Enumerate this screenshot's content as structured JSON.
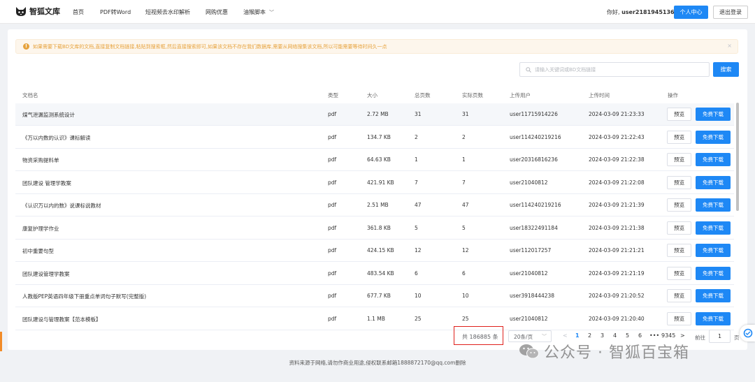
{
  "header": {
    "brand": "智狐文库",
    "nav": [
      "首页",
      "PDF转Word",
      "短视频去水印解析",
      "网购优惠",
      "油猴脚本"
    ],
    "greeting": "你好,",
    "username": "user2181945136",
    "personal_center": "个人中心",
    "logout": "退出登录"
  },
  "notice": {
    "text": "如果需要下载BD文库的文档,直接复制文档链接,粘贴到搜索框,然后直接搜索即可,如果该文档不存在我们数据库,需要从网络搜集该文档,所以可能需要等待时间久一点",
    "close": "×"
  },
  "search": {
    "placeholder": "请输入关键词或BD文档链接",
    "button": "搜索"
  },
  "table": {
    "columns": [
      "文档名",
      "类型",
      "大小",
      "总页数",
      "实际页数",
      "上传用户",
      "上传时间",
      "操作"
    ],
    "preview_label": "预览",
    "download_label": "免费下载",
    "rows": [
      {
        "name": "煤气泄漏监测系统设计",
        "type": "pdf",
        "size": "2.72 MB",
        "total": "31",
        "actual": "31",
        "user": "user11715914226",
        "time": "2024-03-09 21:23:33"
      },
      {
        "name": "《万以内数的认识》课标解读",
        "type": "pdf",
        "size": "134.7 KB",
        "total": "2",
        "actual": "2",
        "user": "user114240219216",
        "time": "2024-03-09 21:22:43"
      },
      {
        "name": "物资采购提料单",
        "type": "pdf",
        "size": "64.63 KB",
        "total": "1",
        "actual": "1",
        "user": "user20316816236",
        "time": "2024-03-09 21:22:38"
      },
      {
        "name": "团队建设 管理学教案",
        "type": "pdf",
        "size": "421.91 KB",
        "total": "7",
        "actual": "7",
        "user": "user21040812",
        "time": "2024-03-09 21:22:08"
      },
      {
        "name": "《认识万以内的数》说课标说教材",
        "type": "pdf",
        "size": "2.51 MB",
        "total": "47",
        "actual": "47",
        "user": "user114240219216",
        "time": "2024-03-09 21:21:39"
      },
      {
        "name": "康复护理学作业",
        "type": "pdf",
        "size": "361.8 KB",
        "total": "5",
        "actual": "5",
        "user": "user18322491184",
        "time": "2024-03-09 21:21:38"
      },
      {
        "name": "初中重要句型",
        "type": "pdf",
        "size": "424.15 KB",
        "total": "12",
        "actual": "12",
        "user": "user112017257",
        "time": "2024-03-09 21:21:21"
      },
      {
        "name": "团队建设管理学教案",
        "type": "pdf",
        "size": "483.54 KB",
        "total": "6",
        "actual": "6",
        "user": "user21040812",
        "time": "2024-03-09 21:21:19"
      },
      {
        "name": "人教版PEP英语四年级下册重点单词句子默写(完整版)",
        "type": "pdf",
        "size": "677.7 KB",
        "total": "10",
        "actual": "10",
        "user": "user3918444238",
        "time": "2024-03-09 21:20:52"
      },
      {
        "name": "团队建设与管理教案【范本模板】",
        "type": "pdf",
        "size": "1.1 MB",
        "total": "25",
        "actual": "25",
        "user": "user21040812",
        "time": "2024-03-09 21:20:40"
      }
    ]
  },
  "pagination": {
    "total": "共 186885 条",
    "page_size": "20条/页",
    "prev": "<",
    "pages": [
      "1",
      "2",
      "3",
      "4",
      "5",
      "6",
      "•••",
      "9345"
    ],
    "next": ">",
    "goto_label": "前往",
    "goto_value": "1",
    "goto_suffix": "页"
  },
  "footer": "资料来源于网络,请勿作商业用途,侵权联系邮箱1888872170@qq.com删除",
  "watermark": "公众号 · 智狐百宝箱",
  "colors": {
    "primary": "#1e88f5",
    "warning": "#e6a23c",
    "highlight_box": "#e0201b"
  }
}
